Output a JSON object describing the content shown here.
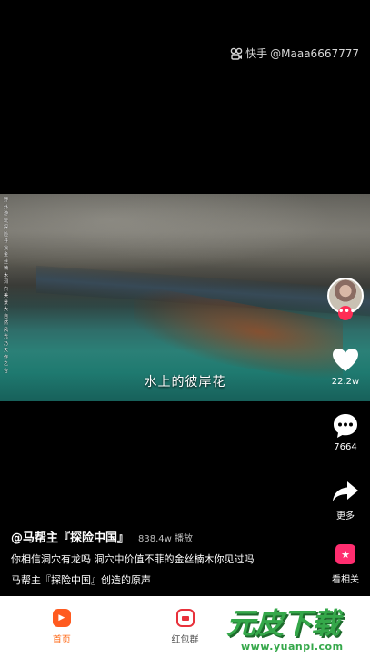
{
  "watermark": {
    "app": "快手",
    "user": "@Maaa6667777"
  },
  "video": {
    "subtitle": "水上的彼岸花",
    "side_caption": "野外游玩探险寻找金丝楠木洞穴美景大自然风光乃天作之合"
  },
  "actions": {
    "like": {
      "icon": "heart-icon",
      "count": "22.2w"
    },
    "comment": {
      "icon": "comment-icon",
      "count": "7664"
    },
    "share": {
      "icon": "share-icon",
      "label": "更多"
    },
    "related": {
      "icon": "star-icon",
      "label": "看相关"
    }
  },
  "info": {
    "author": "@马帮主『探险中国』",
    "plays": "838.4w 播放",
    "description": "你相信洞穴有龙吗  洞穴中价值不菲的金丝楠木你见过吗",
    "music": "马帮主『探险中国』创造的原声"
  },
  "nav": {
    "items": [
      {
        "label": "首页",
        "icon": "home-icon",
        "active": true
      },
      {
        "label": "红包群",
        "icon": "red-envelope-icon",
        "active": false
      }
    ]
  },
  "brand": {
    "big": "元皮下载",
    "small": "www.yuanpi.com"
  },
  "colors": {
    "accent": "#ff6b1a",
    "like": "#ffffff",
    "brand": "#35a84a",
    "badge": "#ff2d55"
  }
}
